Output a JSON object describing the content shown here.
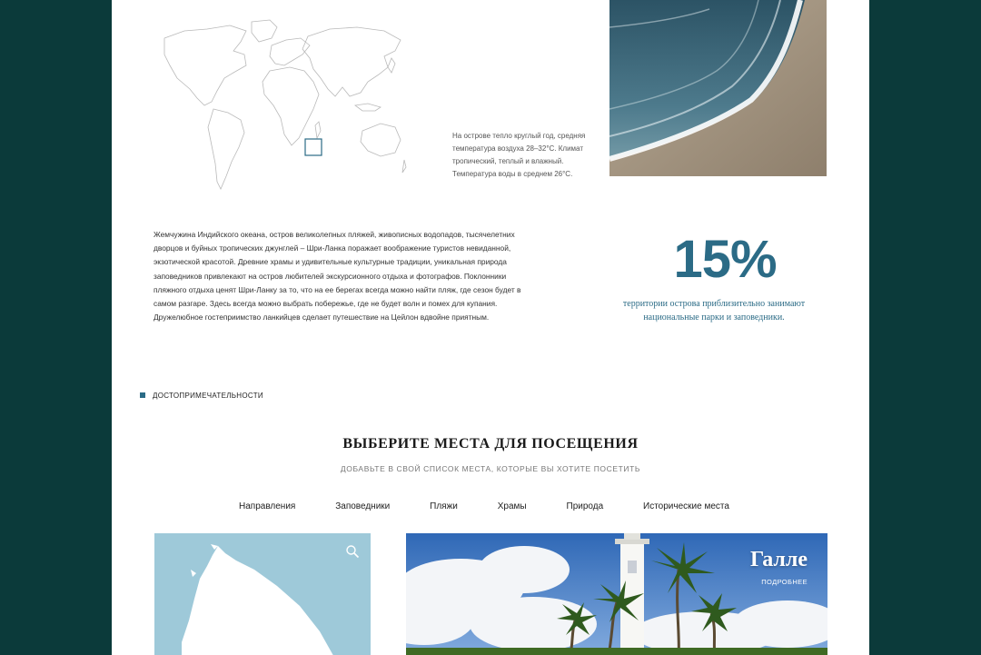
{
  "info": {
    "climate_text": "На острове тепло круглый год, средняя температура воздуха 28–32°C. Климат тропический, теплый и влажный. Температура воды в среднем 26°C.",
    "intro_text": "Жемчужина Индийского океана, остров великолепных пляжей, живописных водопадов, тысячелетних дворцов и буйных тропических джунглей – Шри-Ланка поражает воображение туристов невиданной, экзотической красотой. Древние храмы и удивительные культурные традиции, уникальная природа заповедников привлекают на остров любителей экскурсионного отдыха и фотографов. Поклонники пляжного отдыха ценят Шри-Ланку за то, что на ее берегах всегда можно найти пляж, где сезон будет в самом разгаре. Здесь всегда можно выбрать побережье, где не будет волн и помех для купания. Дружелюбное гостеприимство ланкийцев сделает путешествие на Цейлон вдвойне приятным."
  },
  "stat": {
    "value": "15%",
    "caption": "территории острова приблизительно занимают национальные парки и заповедники."
  },
  "section": {
    "label": "достопримечательности",
    "title": "ВЫБЕРИТЕ МЕСТА ДЛЯ ПОСЕЩЕНИЯ",
    "subtitle": "Добавьте в свой список места, которые вы хотите посетить"
  },
  "tabs": [
    "Направления",
    "Заповедники",
    "Пляжи",
    "Храмы",
    "Природа",
    "Исторические места"
  ],
  "place_card": {
    "city": "Галле",
    "more_label": "подробнее"
  },
  "icons": {
    "search": "search-icon"
  },
  "colors": {
    "background": "#0b3a3a",
    "accent": "#2b6b86",
    "map_water": "#9ec9d9"
  }
}
